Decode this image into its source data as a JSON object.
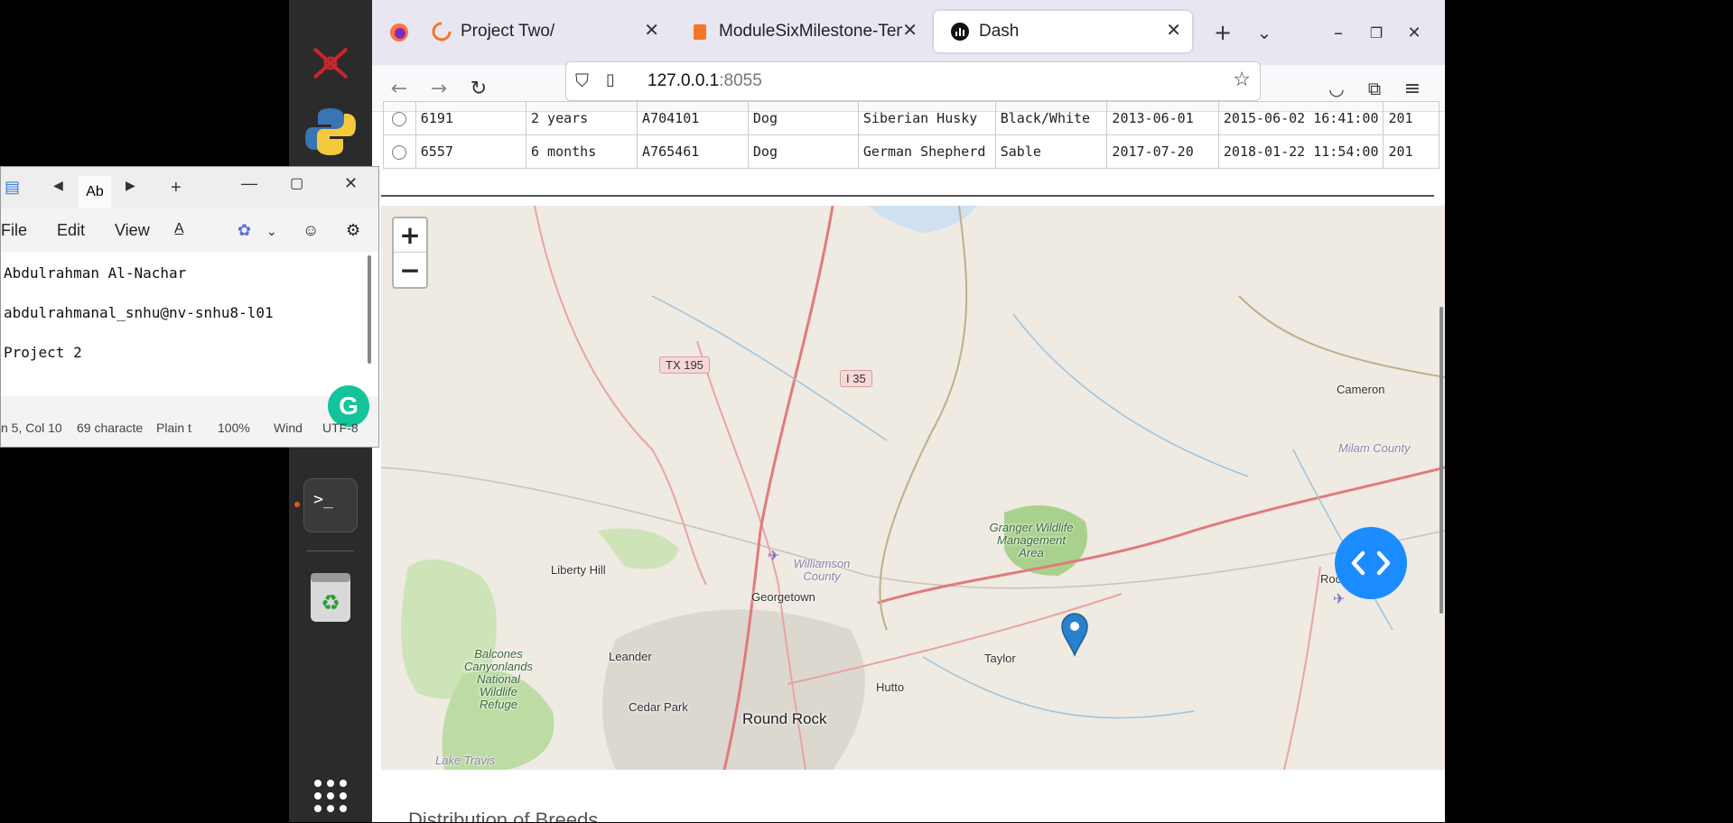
{
  "browser": {
    "tabs": [
      {
        "label": "Project Two/",
        "icon": "loading-icon"
      },
      {
        "label": "ModuleSixMilestone-Tem",
        "icon": "notebook-icon"
      },
      {
        "label": "Dash",
        "icon": "dash-icon",
        "active": true
      }
    ],
    "url_host": "127.0.0.1",
    "url_port": ":8055"
  },
  "table": {
    "rows": [
      [
        "6191",
        "2 years",
        "A704101",
        "Dog",
        "Siberian Husky",
        "Black/White",
        "2013-06-01",
        "2015-06-02 16:41:00",
        "201"
      ],
      [
        "6557",
        "6 months",
        "A765461",
        "Dog",
        "German Shepherd",
        "Sable",
        "2017-07-20",
        "2018-01-22 11:54:00",
        "201"
      ]
    ]
  },
  "map": {
    "zoom_in": "+",
    "zoom_out": "−",
    "shields": [
      "TX 195",
      "I 35"
    ],
    "labels": {
      "cameron": "Cameron",
      "milam": "Milam County",
      "granger": "Granger Wildlife Management Area",
      "williamson": "Williamson County",
      "liberty_hill": "Liberty Hill",
      "georgetown": "Georgetown",
      "rockdale": "Rockdale",
      "taylor": "Taylor",
      "balcones": "Balcones Canyonlands National Wildlife Refuge",
      "leander": "Leander",
      "hutto": "Hutto",
      "cedar_park": "Cedar Park",
      "round_rock": "Round Rock",
      "lake_travis": "Lake Travis"
    }
  },
  "section_title": "Distribution of Breeds",
  "notepad": {
    "tab_label": "Ab",
    "menu": [
      "File",
      "Edit",
      "View"
    ],
    "lines": [
      "Abdulrahman Al-Nachar",
      "abdulrahmanal_snhu@nv-snhu8-l01",
      "Project 2"
    ],
    "status": [
      "n 5, Col 10",
      "69 characte",
      "Plain t",
      "100%",
      "Wind",
      "UTF-8"
    ]
  }
}
